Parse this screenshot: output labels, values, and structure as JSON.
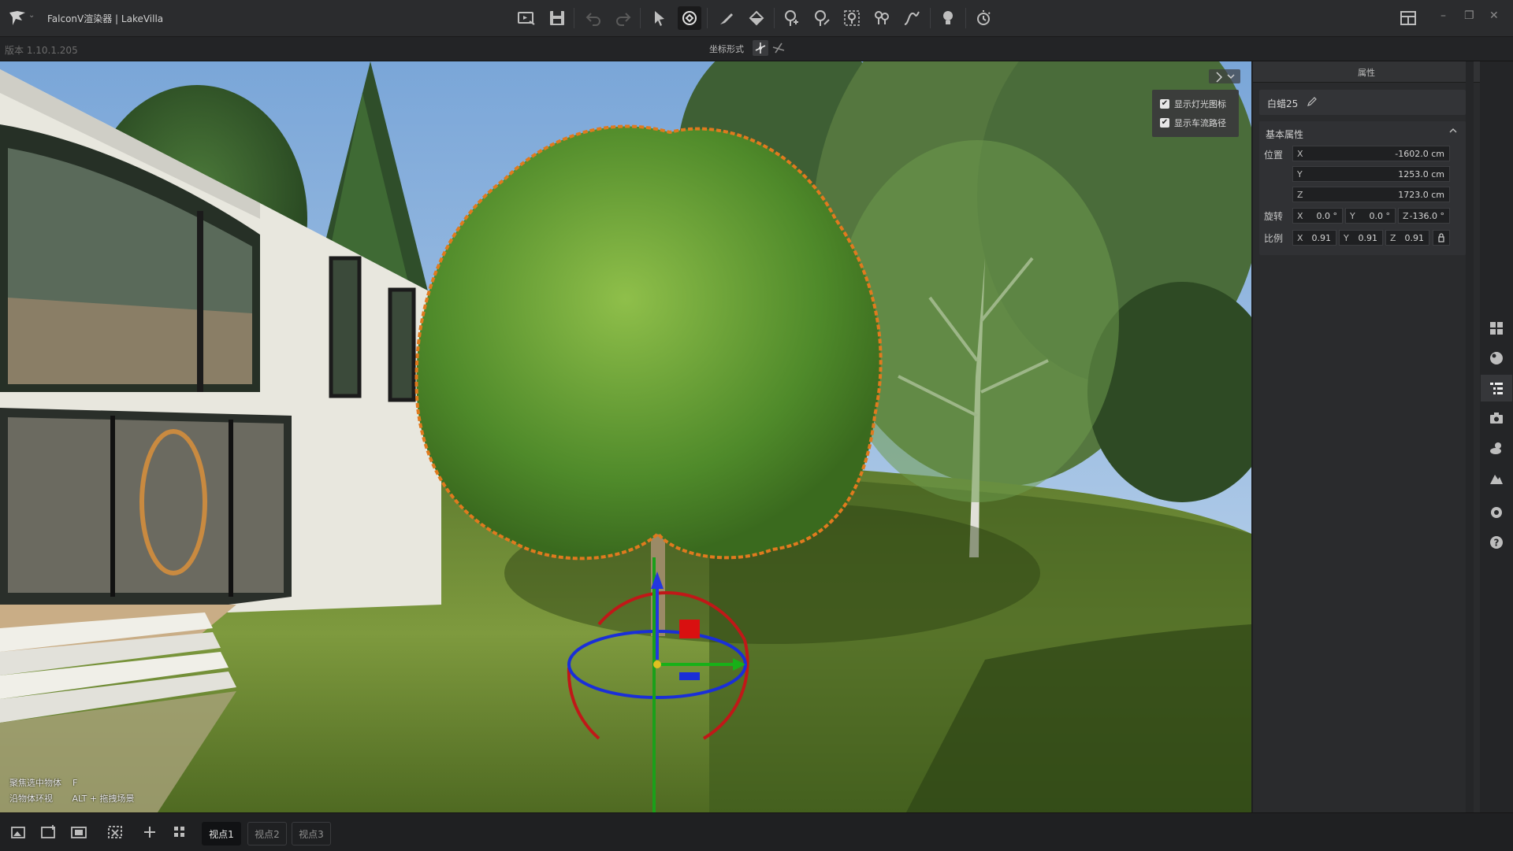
{
  "app": {
    "title": "FalconV渲染器 | LakeVilla",
    "version": "版本 1.10.1.205"
  },
  "toolbar": {
    "icons": [
      "render-icon",
      "save-icon",
      "undo-icon",
      "redo-icon",
      "select-arrow-icon",
      "transform-gizmo-icon",
      "brush-icon",
      "fill-icon",
      "place-tree-icon",
      "tree-brush-icon",
      "tree-scatter-icon",
      "tree-path-icon",
      "curve-icon",
      "light-bulb-icon",
      "time-of-day-icon"
    ],
    "coord_label": "坐标形式"
  },
  "viewport": {
    "options": [
      {
        "label": "显示灯光图标",
        "checked": true
      },
      {
        "label": "显示车流路径",
        "checked": true
      }
    ],
    "hints": [
      "聚焦选中物体    F",
      "沿物体环视       ALT + 拖拽场景"
    ]
  },
  "panel": {
    "title": "属性",
    "object_name": "白蜡25",
    "section_title": "基本属性",
    "position_label": "位置",
    "rotation_label": "旋转",
    "scale_label": "比例",
    "position": {
      "x": "-1602.0 cm",
      "y": "1253.0 cm",
      "z": "1723.0 cm"
    },
    "rotation": {
      "x": "0.0 °",
      "y": "0.0 °",
      "z": "-136.0 °"
    },
    "scale": {
      "x": "0.91",
      "y": "0.91",
      "z": "0.91"
    },
    "axis": {
      "x": "X",
      "y": "Y",
      "z": "Z"
    }
  },
  "rail": {
    "icons": [
      "assets-grid-icon",
      "material-icon",
      "scene-tree-icon",
      "camera-icon",
      "weather-icon",
      "terrain-icon",
      "settings-icon",
      "help-icon"
    ],
    "active": "scene-tree-icon"
  },
  "bottom": {
    "viewpoints": [
      {
        "label": "视点1",
        "active": true
      },
      {
        "label": "视点2",
        "active": false
      },
      {
        "label": "视点3",
        "active": false
      }
    ]
  }
}
